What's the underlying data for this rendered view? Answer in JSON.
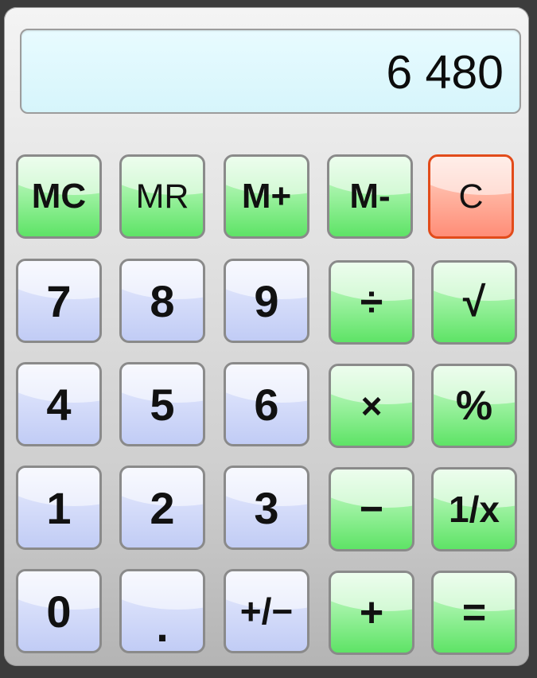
{
  "display": {
    "value": "6 480"
  },
  "keys": {
    "mc": "MC",
    "mr": "MR",
    "m_plus": "M+",
    "m_minus": "M-",
    "clear": "C",
    "seven": "7",
    "eight": "8",
    "nine": "9",
    "divide": "÷",
    "sqrt": "√",
    "four": "4",
    "five": "5",
    "six": "6",
    "multiply": "×",
    "percent": "%",
    "one": "1",
    "two": "2",
    "three": "3",
    "minus": "−",
    "reciprocal": "1/x",
    "zero": "0",
    "decimal": ".",
    "sign": "+/−",
    "plus": "+",
    "equals": "="
  },
  "colors": {
    "display_bg": "#d6f5fb",
    "digit_key": "#c1ccf5",
    "operator_key": "#5ee366",
    "clear_key": "#ff8d77",
    "clear_border": "#e24b1a"
  }
}
